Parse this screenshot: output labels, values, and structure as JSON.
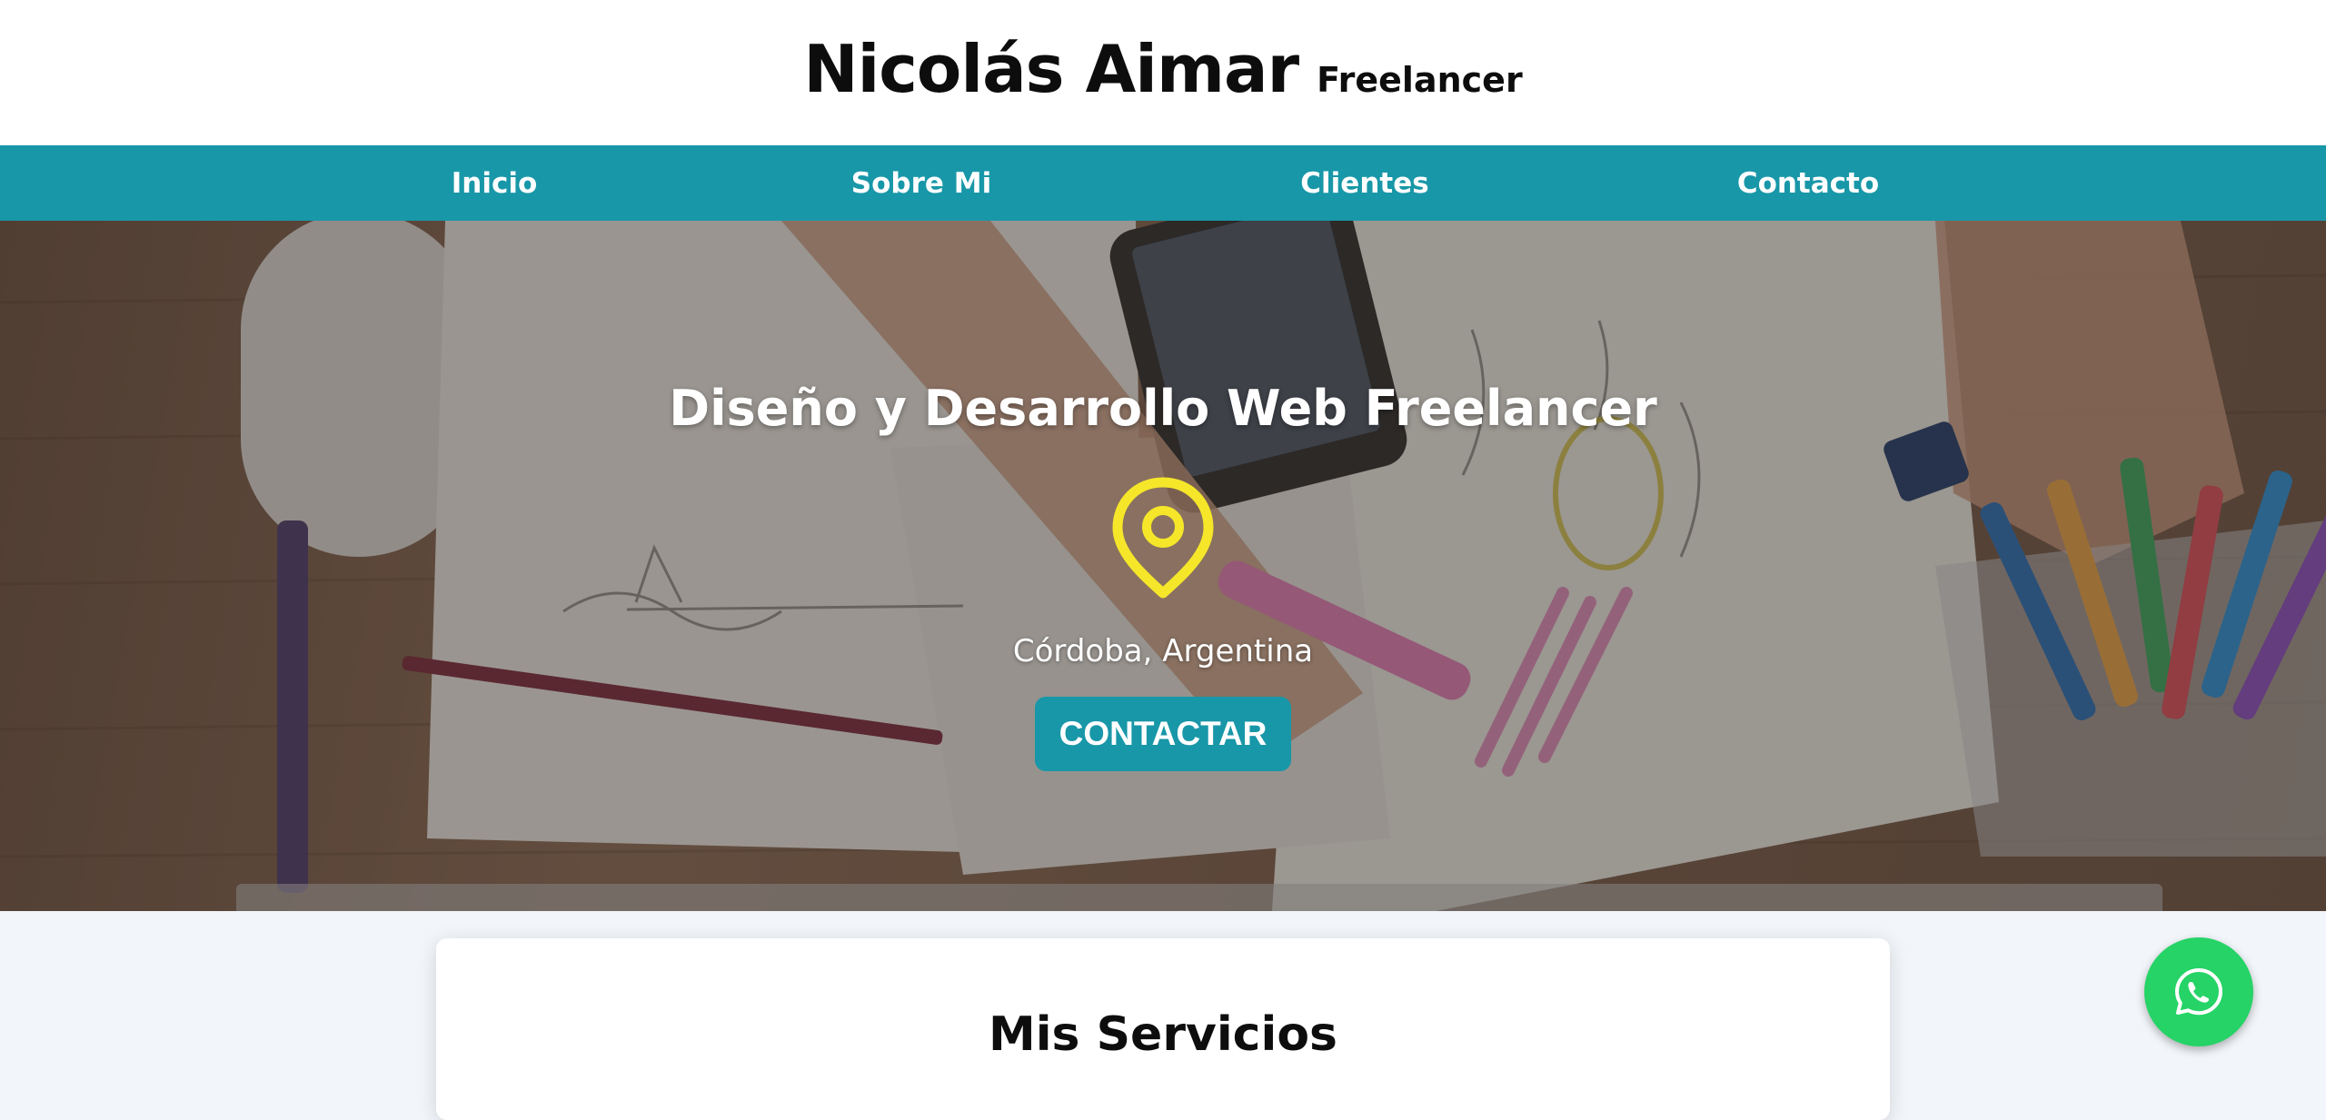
{
  "header": {
    "name": "Nicolás Aimar",
    "role": "Freelancer"
  },
  "nav": {
    "items": [
      {
        "label": "Inicio"
      },
      {
        "label": "Sobre Mi"
      },
      {
        "label": "Clientes"
      },
      {
        "label": "Contacto"
      }
    ]
  },
  "hero": {
    "title": "Diseño y Desarrollo Web Freelancer",
    "location_icon": "map-pin-icon",
    "location": "Córdoba, Argentina",
    "cta_label": "CONTACTAR"
  },
  "services": {
    "title": "Mis Servicios"
  },
  "floating": {
    "icon": "whatsapp-icon"
  },
  "colors": {
    "accent": "#1897a8",
    "pin": "#f5e62a",
    "whatsapp": "#25d366",
    "header_bg": "#ffffff",
    "page_bg": "#f2f5f9"
  }
}
